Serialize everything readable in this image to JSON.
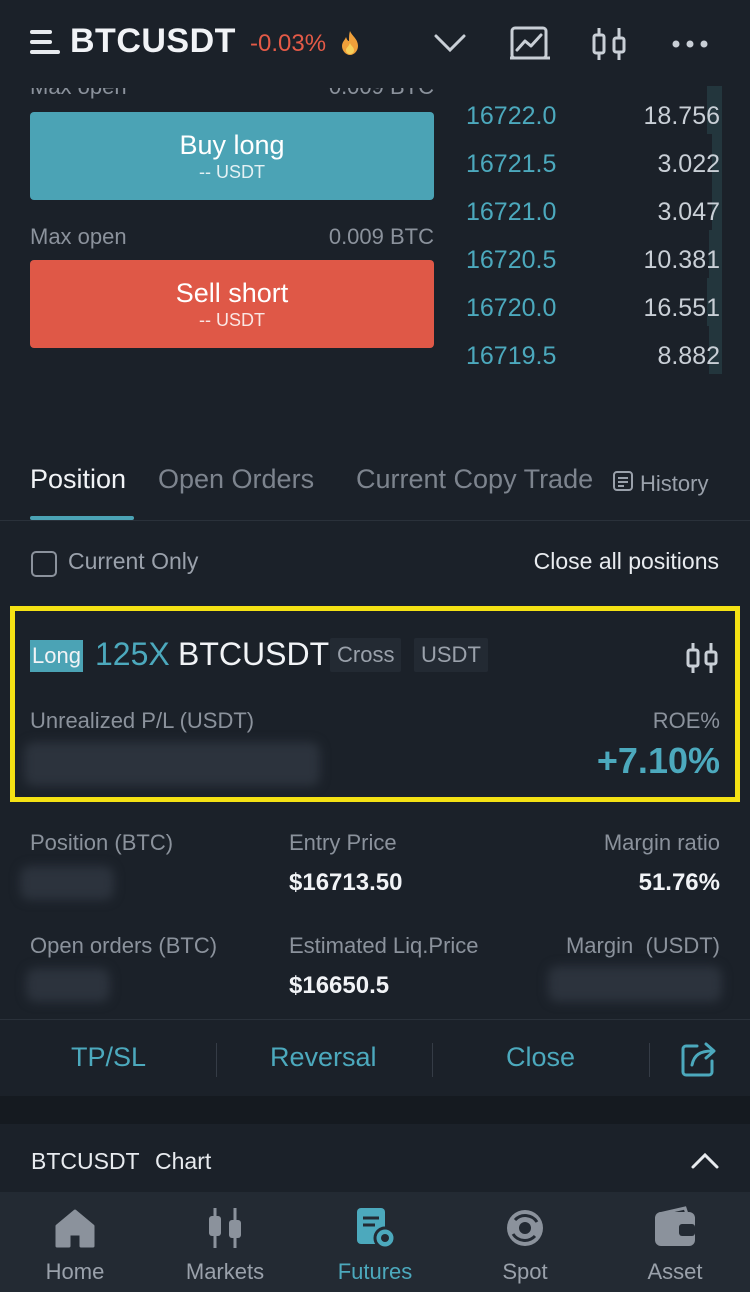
{
  "header": {
    "symbol": "BTCUSDT",
    "change": "-0.03%",
    "icons": [
      "menu-icon",
      "flame-icon",
      "chevron-down-icon",
      "chart-icon",
      "candlestick-icon",
      "more-icon"
    ]
  },
  "trade": {
    "max_open_label": "Max open",
    "max_open_value": "0.009 BTC",
    "buy_label": "Buy long",
    "buy_sub": "-- USDT",
    "sell_label": "Sell short",
    "sell_sub": "-- USDT"
  },
  "orderbook": [
    {
      "price": "16722.0",
      "qty": "18.756",
      "depth": 0.06
    },
    {
      "price": "16721.5",
      "qty": "3.022",
      "depth": 0.04
    },
    {
      "price": "16721.0",
      "qty": "3.047",
      "depth": 0.04
    },
    {
      "price": "16720.5",
      "qty": "10.381",
      "depth": 0.05
    },
    {
      "price": "16720.0",
      "qty": "16.551",
      "depth": 0.06
    },
    {
      "price": "16719.5",
      "qty": "8.882",
      "depth": 0.05
    }
  ],
  "tabs": [
    "Position",
    "Open Orders",
    "Current Copy Trade"
  ],
  "history_label": "History",
  "filters": {
    "current_only": "Current Only",
    "close_all": "Close all positions"
  },
  "position": {
    "side": "Long",
    "leverage": "125X",
    "symbol": "BTCUSDT",
    "margin_mode": "Cross",
    "settle": "USDT",
    "unrealized_label": "Unrealized P/L (USDT)",
    "roe_label": "ROE%",
    "roe_value": "+7.10%",
    "size_label": "Position (BTC)",
    "entry_label": "Entry Price",
    "entry_value": "$16713.50",
    "margin_ratio_label": "Margin ratio",
    "margin_ratio_value": "51.76%",
    "open_orders_label": "Open orders (BTC)",
    "liq_label": "Estimated Liq.Price",
    "liq_value": "$16650.5",
    "margin_label": "Margin  (USDT)"
  },
  "actions": [
    "TP/SL",
    "Reversal",
    "Close"
  ],
  "chart_row": {
    "symbol": "BTCUSDT",
    "label": "Chart"
  },
  "nav": [
    {
      "label": "Home",
      "active": false
    },
    {
      "label": "Markets",
      "active": false
    },
    {
      "label": "Futures",
      "active": true
    },
    {
      "label": "Spot",
      "active": false
    },
    {
      "label": "Asset",
      "active": false
    }
  ],
  "colors": {
    "background": "#1b2129",
    "accent": "#4ba3b5",
    "sell": "#df5847",
    "highlight": "#f5e214"
  }
}
